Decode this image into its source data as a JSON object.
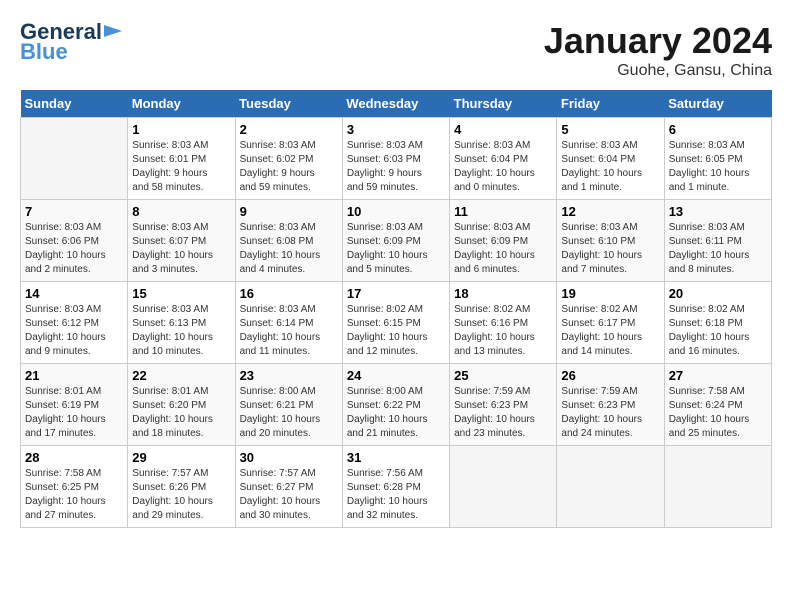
{
  "header": {
    "logo_line1": "General",
    "logo_line2": "Blue",
    "title": "January 2024",
    "subtitle": "Guohe, Gansu, China"
  },
  "calendar": {
    "days_of_week": [
      "Sunday",
      "Monday",
      "Tuesday",
      "Wednesday",
      "Thursday",
      "Friday",
      "Saturday"
    ],
    "weeks": [
      [
        {
          "day": "",
          "info": ""
        },
        {
          "day": "1",
          "info": "Sunrise: 8:03 AM\nSunset: 6:01 PM\nDaylight: 9 hours\nand 58 minutes."
        },
        {
          "day": "2",
          "info": "Sunrise: 8:03 AM\nSunset: 6:02 PM\nDaylight: 9 hours\nand 59 minutes."
        },
        {
          "day": "3",
          "info": "Sunrise: 8:03 AM\nSunset: 6:03 PM\nDaylight: 9 hours\nand 59 minutes."
        },
        {
          "day": "4",
          "info": "Sunrise: 8:03 AM\nSunset: 6:04 PM\nDaylight: 10 hours\nand 0 minutes."
        },
        {
          "day": "5",
          "info": "Sunrise: 8:03 AM\nSunset: 6:04 PM\nDaylight: 10 hours\nand 1 minute."
        },
        {
          "day": "6",
          "info": "Sunrise: 8:03 AM\nSunset: 6:05 PM\nDaylight: 10 hours\nand 1 minute."
        }
      ],
      [
        {
          "day": "7",
          "info": "Sunrise: 8:03 AM\nSunset: 6:06 PM\nDaylight: 10 hours\nand 2 minutes."
        },
        {
          "day": "8",
          "info": "Sunrise: 8:03 AM\nSunset: 6:07 PM\nDaylight: 10 hours\nand 3 minutes."
        },
        {
          "day": "9",
          "info": "Sunrise: 8:03 AM\nSunset: 6:08 PM\nDaylight: 10 hours\nand 4 minutes."
        },
        {
          "day": "10",
          "info": "Sunrise: 8:03 AM\nSunset: 6:09 PM\nDaylight: 10 hours\nand 5 minutes."
        },
        {
          "day": "11",
          "info": "Sunrise: 8:03 AM\nSunset: 6:09 PM\nDaylight: 10 hours\nand 6 minutes."
        },
        {
          "day": "12",
          "info": "Sunrise: 8:03 AM\nSunset: 6:10 PM\nDaylight: 10 hours\nand 7 minutes."
        },
        {
          "day": "13",
          "info": "Sunrise: 8:03 AM\nSunset: 6:11 PM\nDaylight: 10 hours\nand 8 minutes."
        }
      ],
      [
        {
          "day": "14",
          "info": "Sunrise: 8:03 AM\nSunset: 6:12 PM\nDaylight: 10 hours\nand 9 minutes."
        },
        {
          "day": "15",
          "info": "Sunrise: 8:03 AM\nSunset: 6:13 PM\nDaylight: 10 hours\nand 10 minutes."
        },
        {
          "day": "16",
          "info": "Sunrise: 8:03 AM\nSunset: 6:14 PM\nDaylight: 10 hours\nand 11 minutes."
        },
        {
          "day": "17",
          "info": "Sunrise: 8:02 AM\nSunset: 6:15 PM\nDaylight: 10 hours\nand 12 minutes."
        },
        {
          "day": "18",
          "info": "Sunrise: 8:02 AM\nSunset: 6:16 PM\nDaylight: 10 hours\nand 13 minutes."
        },
        {
          "day": "19",
          "info": "Sunrise: 8:02 AM\nSunset: 6:17 PM\nDaylight: 10 hours\nand 14 minutes."
        },
        {
          "day": "20",
          "info": "Sunrise: 8:02 AM\nSunset: 6:18 PM\nDaylight: 10 hours\nand 16 minutes."
        }
      ],
      [
        {
          "day": "21",
          "info": "Sunrise: 8:01 AM\nSunset: 6:19 PM\nDaylight: 10 hours\nand 17 minutes."
        },
        {
          "day": "22",
          "info": "Sunrise: 8:01 AM\nSunset: 6:20 PM\nDaylight: 10 hours\nand 18 minutes."
        },
        {
          "day": "23",
          "info": "Sunrise: 8:00 AM\nSunset: 6:21 PM\nDaylight: 10 hours\nand 20 minutes."
        },
        {
          "day": "24",
          "info": "Sunrise: 8:00 AM\nSunset: 6:22 PM\nDaylight: 10 hours\nand 21 minutes."
        },
        {
          "day": "25",
          "info": "Sunrise: 7:59 AM\nSunset: 6:23 PM\nDaylight: 10 hours\nand 23 minutes."
        },
        {
          "day": "26",
          "info": "Sunrise: 7:59 AM\nSunset: 6:23 PM\nDaylight: 10 hours\nand 24 minutes."
        },
        {
          "day": "27",
          "info": "Sunrise: 7:58 AM\nSunset: 6:24 PM\nDaylight: 10 hours\nand 25 minutes."
        }
      ],
      [
        {
          "day": "28",
          "info": "Sunrise: 7:58 AM\nSunset: 6:25 PM\nDaylight: 10 hours\nand 27 minutes."
        },
        {
          "day": "29",
          "info": "Sunrise: 7:57 AM\nSunset: 6:26 PM\nDaylight: 10 hours\nand 29 minutes."
        },
        {
          "day": "30",
          "info": "Sunrise: 7:57 AM\nSunset: 6:27 PM\nDaylight: 10 hours\nand 30 minutes."
        },
        {
          "day": "31",
          "info": "Sunrise: 7:56 AM\nSunset: 6:28 PM\nDaylight: 10 hours\nand 32 minutes."
        },
        {
          "day": "",
          "info": ""
        },
        {
          "day": "",
          "info": ""
        },
        {
          "day": "",
          "info": ""
        }
      ]
    ]
  }
}
